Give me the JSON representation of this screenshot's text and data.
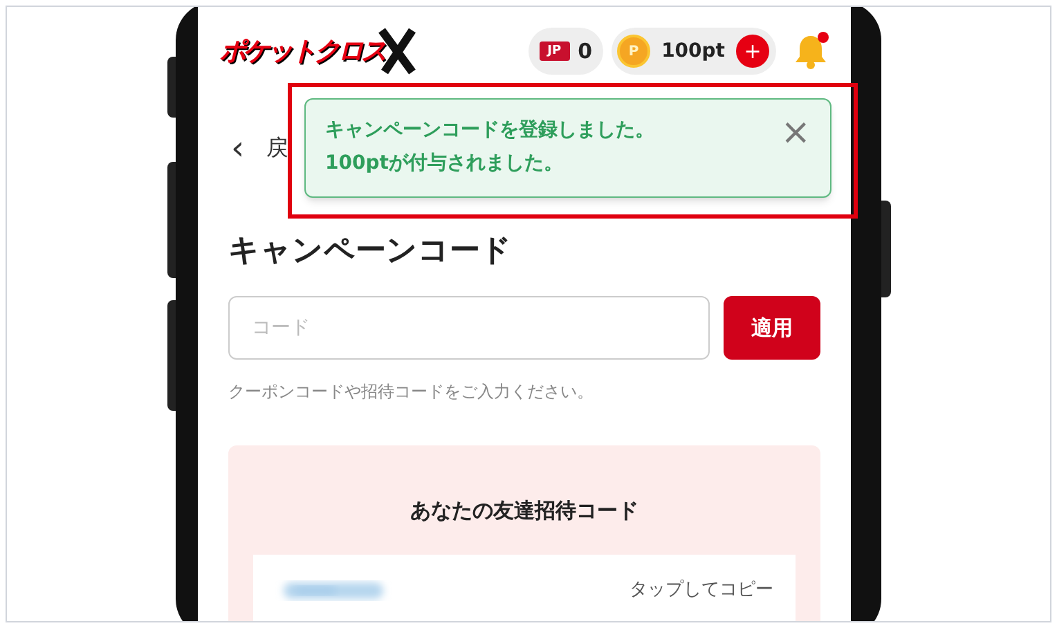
{
  "header": {
    "logo": "ポケットクロス",
    "tickets": {
      "badge": "JP",
      "count": "0"
    },
    "points": {
      "coin": "P",
      "amount": "100pt",
      "add": "+"
    },
    "notification": {
      "unread": true
    }
  },
  "back": {
    "arrow": "‹",
    "label": "戻"
  },
  "toast": {
    "lines": [
      "キャンペーンコードを登録しました。",
      "100ptが付与されました。"
    ],
    "close": "×",
    "highlighted": true
  },
  "title": "キャンペーンコード",
  "code_field": {
    "placeholder": "コード"
  },
  "apply_button": "適用",
  "hint": "クーポンコードや招待コードをご入力ください。",
  "invite_card": {
    "title": "あなたの友達招待コード",
    "copy": "タップしてコピー"
  }
}
